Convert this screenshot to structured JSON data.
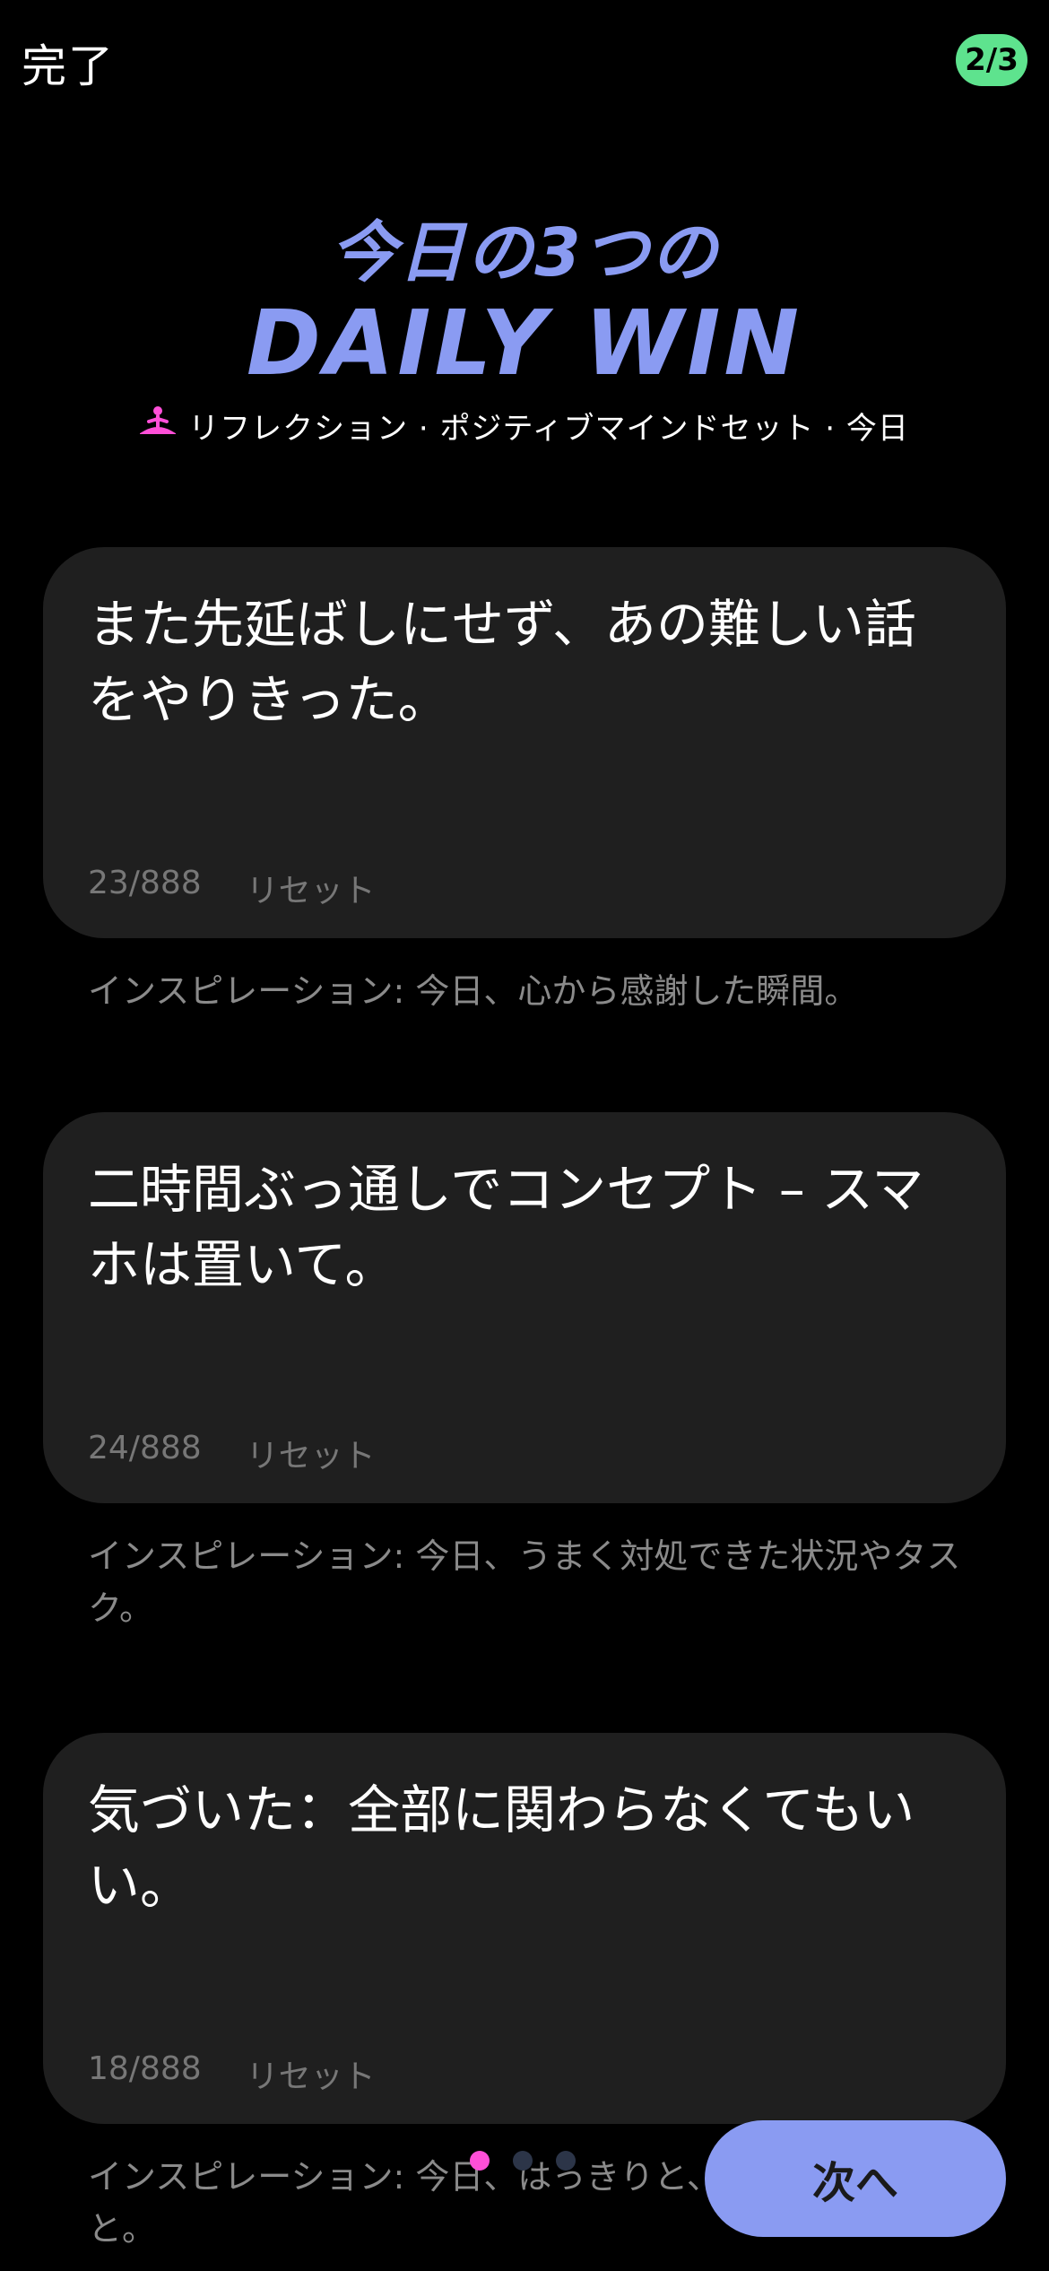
{
  "header": {
    "done_label": "完了",
    "step_badge": "2/3"
  },
  "title": {
    "line1": "今日の3つの",
    "line2": "DAILY WIN"
  },
  "subtitle": {
    "icon": "meditation-icon",
    "text": "リフレクション · ポジティブマインドセット · 今日"
  },
  "entries": [
    {
      "text": "また先延ばしにせず、あの難しい話をやりきった。",
      "count": "23/888",
      "reset_label": "リセット",
      "inspiration": "インスピレーション: 今日、心から感謝した瞬間。"
    },
    {
      "text": "二時間ぶっ通しでコンセプト – スマホは置いて。",
      "count": "24/888",
      "reset_label": "リセット",
      "inspiration": "インスピレーション: 今日、うまく対処できた状況やタスク。"
    },
    {
      "text": "気づいた：全部に関わらなくてもいい。",
      "count": "18/888",
      "reset_label": "リセット",
      "inspiration": "インスピレーション: 今日、はっきりと、または学んだこと。"
    }
  ],
  "pagination": {
    "active_index": 0,
    "total": 3
  },
  "next_label": "次へ",
  "colors": {
    "accent": "#8a9bf2",
    "badge": "#5ee38e",
    "active_dot": "#ff4fd8",
    "card": "#1f1f1f"
  }
}
